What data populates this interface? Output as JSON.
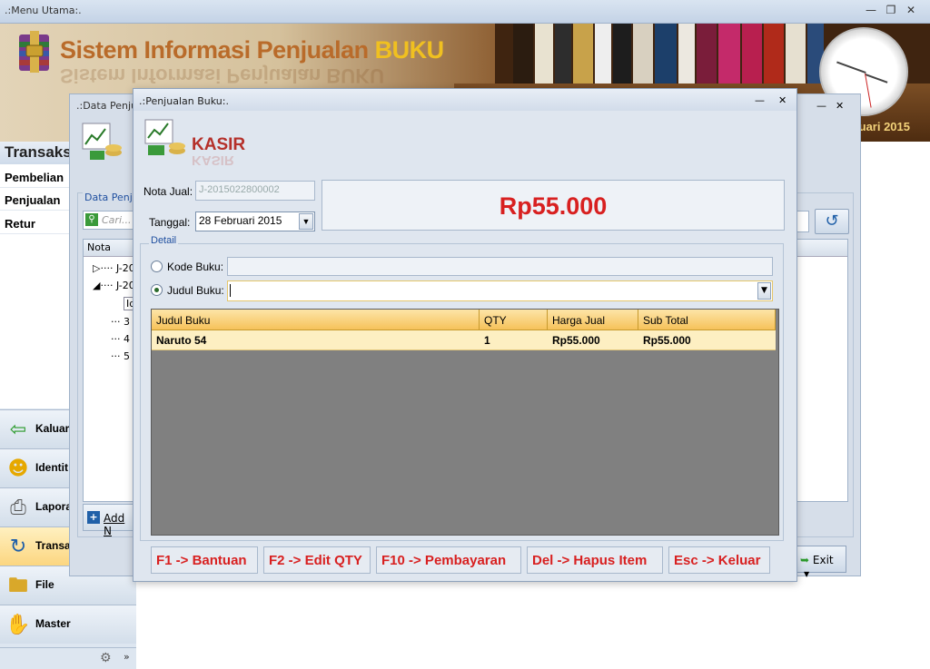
{
  "window": {
    "title": ".:Menu Utama:.",
    "controls": [
      "minimize-icon",
      "restore-icon",
      "close-icon"
    ]
  },
  "banner": {
    "title_part1": "Sistem Informasi Penjualan",
    "title_part2": "BUKU",
    "date_text": "uari 2015"
  },
  "sidebar": {
    "header": "Transaks",
    "subitems": [
      "Pembelian",
      "Penjualan",
      "Retur"
    ],
    "nav": [
      {
        "label": "Kaluar",
        "icon": "exit-door-icon"
      },
      {
        "label": "Identit",
        "icon": "smiley-icon"
      },
      {
        "label": "Lapora",
        "icon": "printer-icon"
      },
      {
        "label": "Transa",
        "icon": "refresh-arrows-icon",
        "active": true
      },
      {
        "label": "File",
        "icon": "folder-icon"
      },
      {
        "label": "Master",
        "icon": "hand-icon"
      }
    ]
  },
  "data_penjualan": {
    "title": ".:Data Penju",
    "group_label": "Data Penju",
    "search_placeholder": "Cari...",
    "grid_header": "Nota",
    "tree_items": [
      "J-201",
      "J-201",
      "Id",
      "3",
      "4",
      "5"
    ],
    "add_button": "Add N",
    "exit_button": "Exit"
  },
  "kasir": {
    "window_title": ".:Penjualan Buku:.",
    "heading": "KASIR",
    "nota_label": "Nota Jual:",
    "nota_value": "J-2015022800002",
    "tanggal_label": "Tanggal:",
    "tanggal_value": "28   Februari   2015",
    "total": "Rp55.000",
    "detail_label": "Detail",
    "kode_buku_label": "Kode Buku:",
    "judul_buku_label": "Judul Buku:",
    "selected_option": "judul_buku",
    "grid": {
      "columns": [
        "Judul Buku",
        "QTY",
        "Harga Jual",
        "Sub Total"
      ],
      "rows": [
        [
          "Naruto 54",
          "1",
          "Rp55.000",
          "Rp55.000"
        ]
      ]
    },
    "function_keys": [
      "F1 -> Bantuan",
      "F2 -> Edit QTY",
      "F10 -> Pembayaran",
      "Del -> Hapus Item",
      "Esc -> Keluar"
    ]
  },
  "colors": {
    "accent_red": "#d82020",
    "heading_red": "#b5302a",
    "grid_header_orange": "#f6c25a",
    "selected_row": "#fdefc2"
  }
}
